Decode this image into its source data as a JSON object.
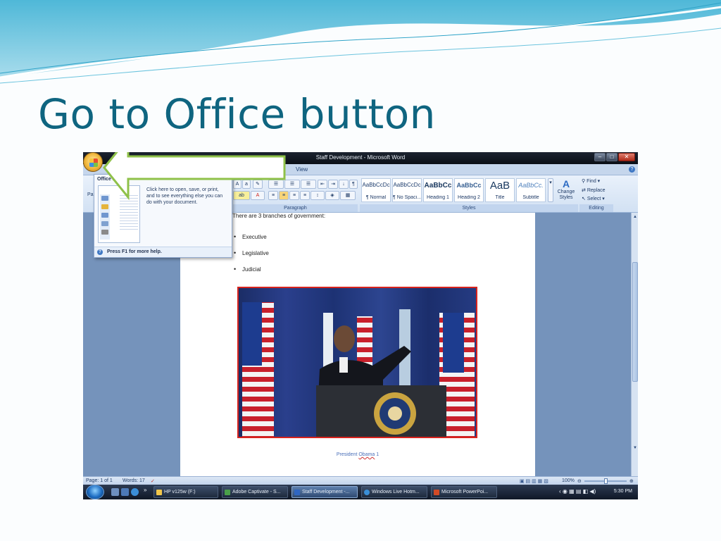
{
  "slide": {
    "title": "Go to Office button"
  },
  "window": {
    "title": "Staff Development - Microsoft Word",
    "controls": [
      "–",
      "□",
      "✕"
    ]
  },
  "ribbon": {
    "visible_tab": "View",
    "styles": [
      {
        "sample": "AaBbCcDc",
        "name": "¶ Normal"
      },
      {
        "sample": "AaBbCcDc",
        "name": "¶ No Spaci..."
      },
      {
        "sample": "AaBbCc",
        "name": "Heading 1"
      },
      {
        "sample": "AaBbCc",
        "name": "Heading 2"
      },
      {
        "sample": "AaB",
        "name": "Title"
      },
      {
        "sample": "AaBbCc.",
        "name": "Subtitle"
      }
    ],
    "change_styles": "Change Styles",
    "editing": {
      "find": "Find",
      "replace": "Replace",
      "select": "Select"
    },
    "group_labels": {
      "paragraph": "Paragraph",
      "styles": "Styles",
      "editing": "Editing"
    },
    "clipboard_partial": "Pa"
  },
  "office_menu": {
    "title": "Office Bu",
    "description": "Click here to open, save, or print, and to see everything else you can do with your document.",
    "footer": "Press F1 for more help."
  },
  "document": {
    "intro_line": "There are 3 branches of government:",
    "bullets": [
      "Executive",
      "Legislative",
      "Judicial"
    ],
    "caption_prefix": "President ",
    "caption_name": "Obama",
    "caption_suffix": " 1"
  },
  "status": {
    "page": "Page: 1 of 1",
    "words": "Words: 17",
    "zoom": "100%"
  },
  "taskbar": {
    "items": [
      "HP v125w (F:)",
      "Adobe Captivate - S...",
      "Staff Development -...",
      "Windows Live Hotm...",
      "Microsoft PowerPoi..."
    ],
    "time": "5:30 PM"
  },
  "colors": {
    "title": "#0f6580",
    "highlight_arrow": "#8fc149",
    "photo_border": "#d8231d"
  }
}
